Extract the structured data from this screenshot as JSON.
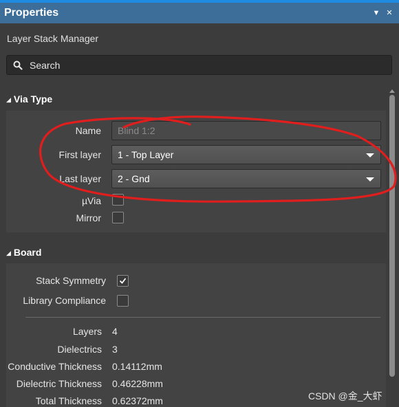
{
  "window": {
    "title": "Properties",
    "menu_icon": "dropdown-triangle-icon",
    "close_icon": "close-icon"
  },
  "subtitle": "Layer Stack Manager",
  "search": {
    "label": "Search",
    "icon": "search-icon"
  },
  "via_type": {
    "header": "Via Type",
    "name_label": "Name",
    "name_value": "Blind 1:2",
    "first_layer_label": "First layer",
    "first_layer_value": "1 - Top Layer",
    "last_layer_label": "Last layer",
    "last_layer_value": "2 - Gnd",
    "uvia_label": "µVia",
    "uvia_checked": false,
    "mirror_label": "Mirror",
    "mirror_checked": false
  },
  "board": {
    "header": "Board",
    "stack_symmetry_label": "Stack Symmetry",
    "stack_symmetry_checked": true,
    "library_compliance_label": "Library Compliance",
    "library_compliance_checked": false,
    "stats": [
      {
        "label": "Layers",
        "value": "4"
      },
      {
        "label": "Dielectrics",
        "value": "3"
      },
      {
        "label": "Conductive Thickness",
        "value": "0.14112mm"
      },
      {
        "label": "Dielectric Thickness",
        "value": "0.46228mm"
      },
      {
        "label": "Total Thickness",
        "value": "0.62372mm"
      }
    ]
  },
  "colors": {
    "accent": "#1e8ae0",
    "titlebar": "#3d6d99",
    "background": "#3c3c3c",
    "annotation": "#e01e1e"
  },
  "watermark": "CSDN @金_大虾"
}
